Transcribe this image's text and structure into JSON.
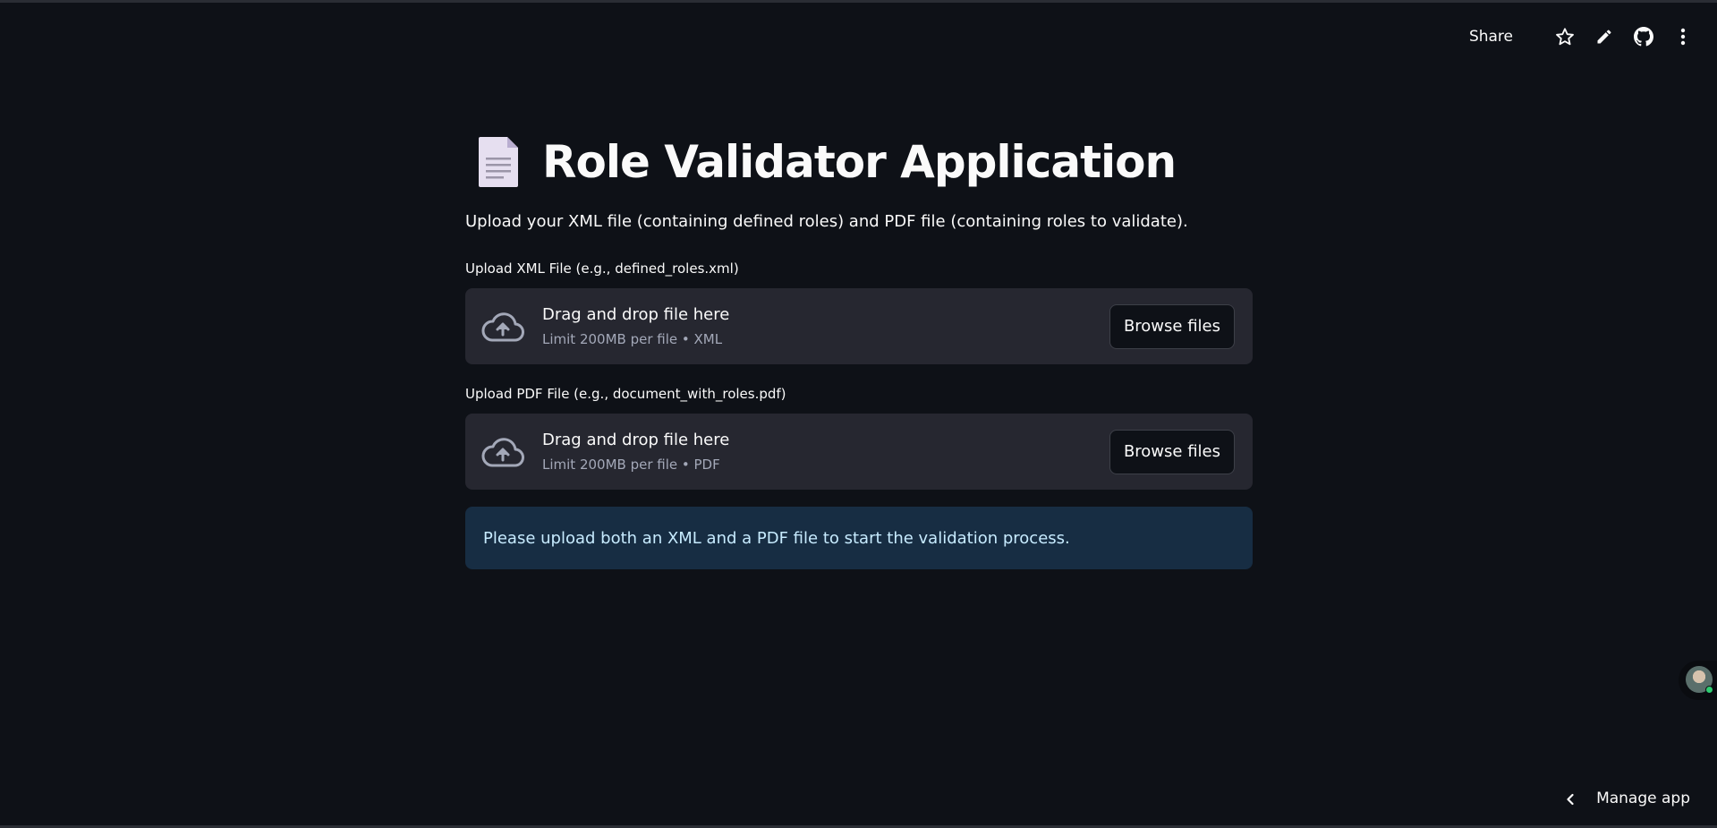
{
  "toolbar": {
    "share_label": "Share",
    "icons": [
      "star-icon",
      "pencil-icon",
      "github-icon",
      "more-vertical-icon"
    ]
  },
  "page": {
    "title": "Role Validator Application",
    "title_icon": "document-icon",
    "subtitle": "Upload your XML file (containing defined roles) and PDF file (containing roles to validate)."
  },
  "uploaders": [
    {
      "label": "Upload XML File (e.g., defined_roles.xml)",
      "drop_text": "Drag and drop file here",
      "limit_text": "Limit 200MB per file • XML",
      "button_label": "Browse files",
      "icon": "cloud-upload-icon"
    },
    {
      "label": "Upload PDF File (e.g., document_with_roles.pdf)",
      "drop_text": "Drag and drop file here",
      "limit_text": "Limit 200MB per file • PDF",
      "button_label": "Browse files",
      "icon": "cloud-upload-icon"
    }
  ],
  "info": {
    "message": "Please upload both an XML and a PDF file to start the validation process."
  },
  "footer": {
    "manage_app_label": "Manage app"
  },
  "colors": {
    "background": "#0e1117",
    "dropzone": "#262730",
    "info_bg": "#172d43",
    "info_text": "#c7ebff",
    "online": "#2ecc71"
  }
}
